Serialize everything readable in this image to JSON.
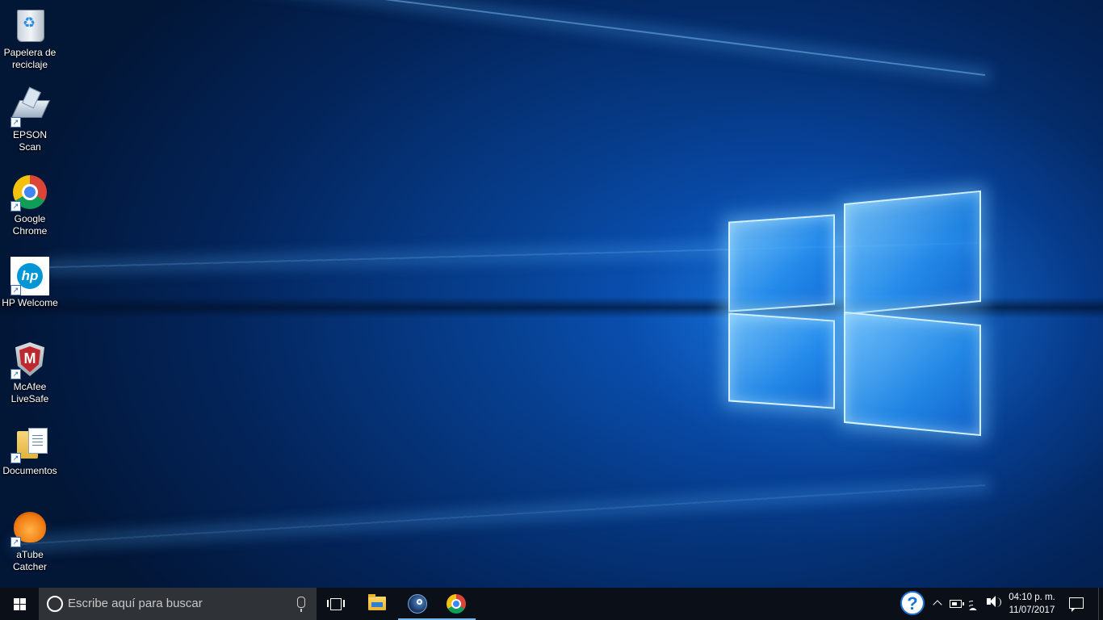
{
  "desktop": {
    "icons": [
      {
        "label": "Papelera de reciclaje",
        "icon": "recycle-bin-icon",
        "shortcut": false
      },
      {
        "label": "EPSON Scan",
        "icon": "scanner-icon",
        "shortcut": true
      },
      {
        "label": "Google Chrome",
        "icon": "chrome-icon",
        "shortcut": true
      },
      {
        "label": "HP Welcome",
        "icon": "hp-icon",
        "shortcut": true
      },
      {
        "label": "McAfee LiveSafe",
        "icon": "mcafee-shield-icon",
        "shortcut": true
      },
      {
        "label": "Documentos",
        "icon": "documents-folder-icon",
        "shortcut": true
      },
      {
        "label": "aTube Catcher",
        "icon": "atube-catcher-icon",
        "shortcut": true
      }
    ],
    "wallpaper": "windows-logo-light-beams",
    "accent_color": "#0a56b8"
  },
  "taskbar": {
    "search_placeholder": "Escribe aquí para buscar",
    "pinned_apps": [
      {
        "name": "file-explorer",
        "icon": "folder-icon",
        "active": false
      },
      {
        "name": "steam",
        "icon": "steam-icon",
        "active": true
      },
      {
        "name": "google-chrome",
        "icon": "chrome-icon",
        "active": true
      }
    ],
    "tray": {
      "help": "help-icon",
      "chevron": "chevron-up-icon",
      "battery": "battery-icon",
      "network": "wifi-icon",
      "volume": "speaker-icon"
    },
    "clock": {
      "time": "04:10 p. m.",
      "date": "11/07/2017"
    },
    "background_color": "#0b0f18",
    "active_indicator_color": "#76b9ed"
  }
}
